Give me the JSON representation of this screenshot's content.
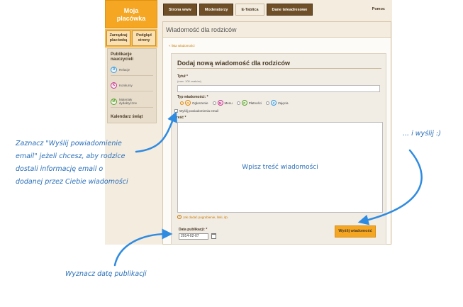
{
  "logo": {
    "line1": "Moja",
    "line2": "placówka"
  },
  "side_buttons": [
    {
      "line1": "Zarządzaj",
      "line2": "placówką"
    },
    {
      "line1": "Podgląd",
      "line2": "strony"
    }
  ],
  "sidebar": {
    "heading_line1": "Publikacje",
    "heading_line2": "nauczycieli",
    "items": [
      {
        "letter": "R",
        "label": "Relacje"
      },
      {
        "letter": "K",
        "label": "Konkursy"
      },
      {
        "letter": "M",
        "label_line1": "Materiały",
        "label_line2": "dydaktyczne"
      }
    ],
    "calendar": "Kalendarz świąt"
  },
  "nav": {
    "tabs": [
      "Strona www",
      "Moderatorzy",
      "E-Tablica",
      "Dane teleadresowe"
    ],
    "active_index": 2,
    "help": "Pomoc"
  },
  "main": {
    "title": "Wiadomość dla rodziców",
    "back_link": "« lista wiadomości"
  },
  "form": {
    "title": "Dodaj nową wiadomość dla rodziców",
    "title_label": "Tytuł *",
    "title_hint": "(max. 100 znaków)",
    "type_label": "Typ wiadomości: *",
    "types": [
      {
        "letter": "O",
        "label": "Ogłoszenie",
        "color": "#e08a12",
        "selected": true
      },
      {
        "letter": "M",
        "label": "Menu",
        "color": "#c23b8a",
        "selected": false
      },
      {
        "letter": "P",
        "label": "Płatności",
        "color": "#5aa02c",
        "selected": false
      },
      {
        "letter": "Z",
        "label": "Zajęcia",
        "color": "#3a9ad9",
        "selected": false
      }
    ],
    "email_checkbox_label": "Wyślij powiadomienia email",
    "content_label": "Treść *",
    "content_placeholder": "Wpisz treść wiadomości",
    "format_link": "Jak dodać pogrubienie, linki, itp.",
    "date_label": "Data publikacji: *",
    "date_value": "2014-02-07",
    "submit_label": "Wyślij wiadomość"
  },
  "annotations": {
    "email_note": [
      "Zaznacz \"Wyślij powiadomienie",
      "email\" jeżeli chcesz, aby rodzice",
      "dostali informację email o",
      "dodanej przez Ciebie wiadomości"
    ],
    "send_note": "... i wyślij :)",
    "date_note": "Wyznacz datę publikacji"
  }
}
